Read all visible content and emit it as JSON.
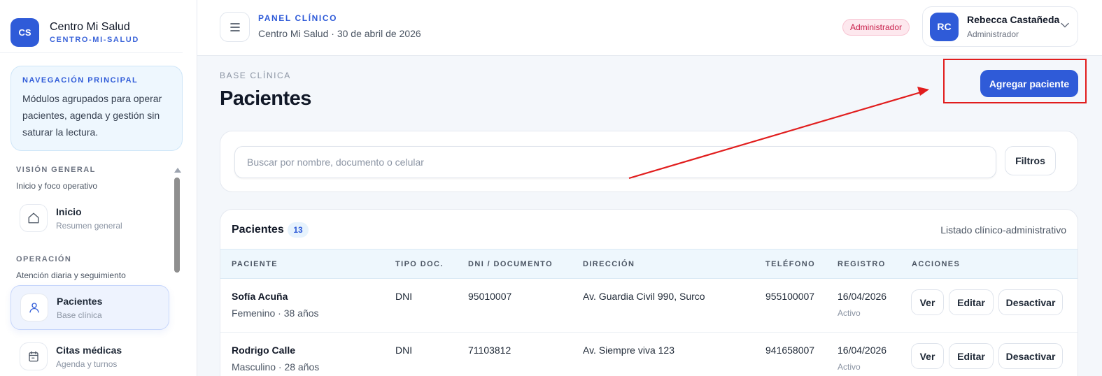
{
  "brand": {
    "initials": "CS",
    "name": "Centro Mi Salud",
    "slug": "CENTRO-MI-SALUD"
  },
  "nav_card": {
    "title": "NAVEGACIÓN PRINCIPAL",
    "text": "Módulos agrupados para operar pacientes, agenda y gestión sin saturar la lectura."
  },
  "sidebar": {
    "sections": [
      {
        "title": "VISIÓN GENERAL",
        "subtitle": "Inicio y foco operativo"
      },
      {
        "title": "OPERACIÓN",
        "subtitle": "Atención diaria y seguimiento"
      }
    ],
    "items": [
      {
        "label": "Inicio",
        "sub": "Resumen general",
        "icon": "home-icon",
        "active": false
      },
      {
        "label": "Pacientes",
        "sub": "Base clínica",
        "icon": "user-icon",
        "active": true
      },
      {
        "label": "Citas médicas",
        "sub": "Agenda y turnos",
        "icon": "calendar-icon",
        "active": false
      }
    ]
  },
  "header": {
    "kicker": "PANEL CLÍNICO",
    "subtitle": "Centro Mi Salud · 30 de abril de 2026",
    "role_badge": "Administrador",
    "user": {
      "initials": "RC",
      "name": "Rebecca Castañeda",
      "role": "Administrador"
    }
  },
  "page": {
    "kicker": "BASE CLÍNICA",
    "title": "Pacientes",
    "add_button": "Agregar paciente"
  },
  "search": {
    "placeholder": "Buscar por nombre, documento o celular",
    "value": "",
    "filter_button": "Filtros"
  },
  "table": {
    "title": "Pacientes",
    "count": "13",
    "caption": "Listado clínico-administrativo",
    "columns": [
      "PACIENTE",
      "TIPO DOC.",
      "DNI / DOCUMENTO",
      "DIRECCIÓN",
      "TELÉFONO",
      "REGISTRO",
      "ACCIONES"
    ],
    "rows": [
      {
        "name": "Sofía Acuña",
        "detail": "Femenino · 38 años",
        "doc_type": "DNI",
        "doc": "95010007",
        "address": "Av. Guardia Civil 990, Surco",
        "phone": "955100007",
        "date": "16/04/2026",
        "status": "Activo"
      },
      {
        "name": "Rodrigo Calle",
        "detail": "Masculino · 28 años",
        "doc_type": "DNI",
        "doc": "71103812",
        "address": "Av. Siempre viva 123",
        "phone": "941658007",
        "date": "16/04/2026",
        "status": "Activo"
      }
    ],
    "actions": {
      "view": "Ver",
      "edit": "Editar",
      "deactivate": "Desactivar"
    }
  },
  "colors": {
    "accent": "#2f5bd8",
    "annotation": "#e11d1d",
    "badge": "#c81e4a"
  }
}
